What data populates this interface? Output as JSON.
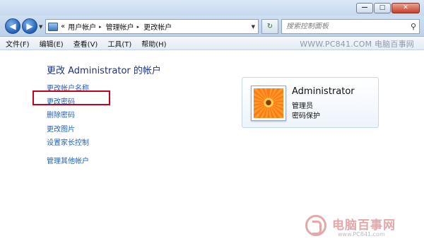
{
  "window": {
    "buttons": [
      {
        "name": "minimize",
        "glyph": "—"
      },
      {
        "name": "maximize",
        "glyph": "□"
      },
      {
        "name": "close",
        "glyph": "✕"
      }
    ]
  },
  "address": {
    "prefix": "«",
    "crumbs": [
      "用户帐户",
      "管理帐户",
      "更改帐户"
    ],
    "separator": "▸"
  },
  "search": {
    "placeholder": "搜索控制面板"
  },
  "menu": {
    "items": [
      "文件(F)",
      "编辑(E)",
      "查看(V)",
      "工具(T)",
      "帮助(H)"
    ]
  },
  "watermark": {
    "top": "WWW.PC841.COM 电脑百事网",
    "brand_name": "电脑百事网",
    "brand_url": "www.PC841.com"
  },
  "main": {
    "title": "更改 Administrator 的帐户",
    "links": [
      "更改帐户名称",
      "更改密码",
      "删除密码",
      "更改图片",
      "设置家长控制",
      "管理其他帐户"
    ],
    "highlighted_link": "更改密码",
    "highlight_color": "#c8001c"
  },
  "user_card": {
    "name": "Administrator",
    "role": "管理员",
    "status": "密码保护"
  },
  "colors": {
    "link": "#1c61c0",
    "title": "#1e3287"
  }
}
